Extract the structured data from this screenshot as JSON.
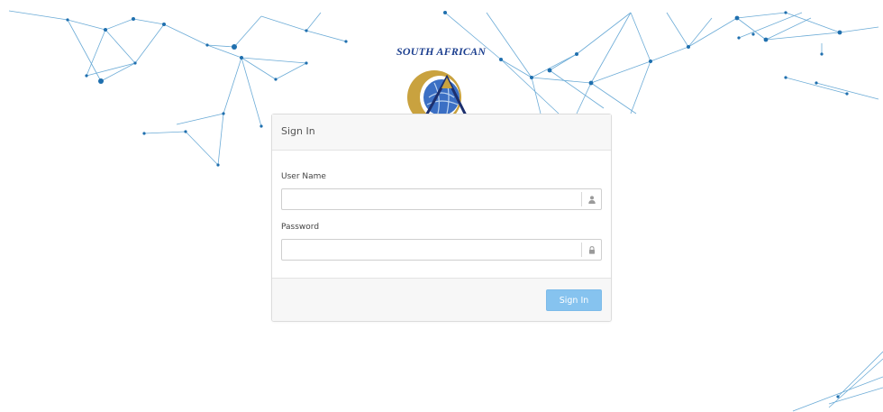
{
  "logo": {
    "text": "SOUTH AFRICAN"
  },
  "panel": {
    "title": "Sign In"
  },
  "form": {
    "username_label": "User Name",
    "username_value": "",
    "password_label": "Password",
    "password_value": "",
    "submit_label": "Sign In"
  },
  "icons": {
    "username": "user-icon",
    "password": "lock-icon"
  },
  "colors": {
    "network_line": "#3a8fc9",
    "network_dot": "#1f6fae",
    "button": "#86c3ef",
    "logo_text": "#1c3f8f"
  }
}
